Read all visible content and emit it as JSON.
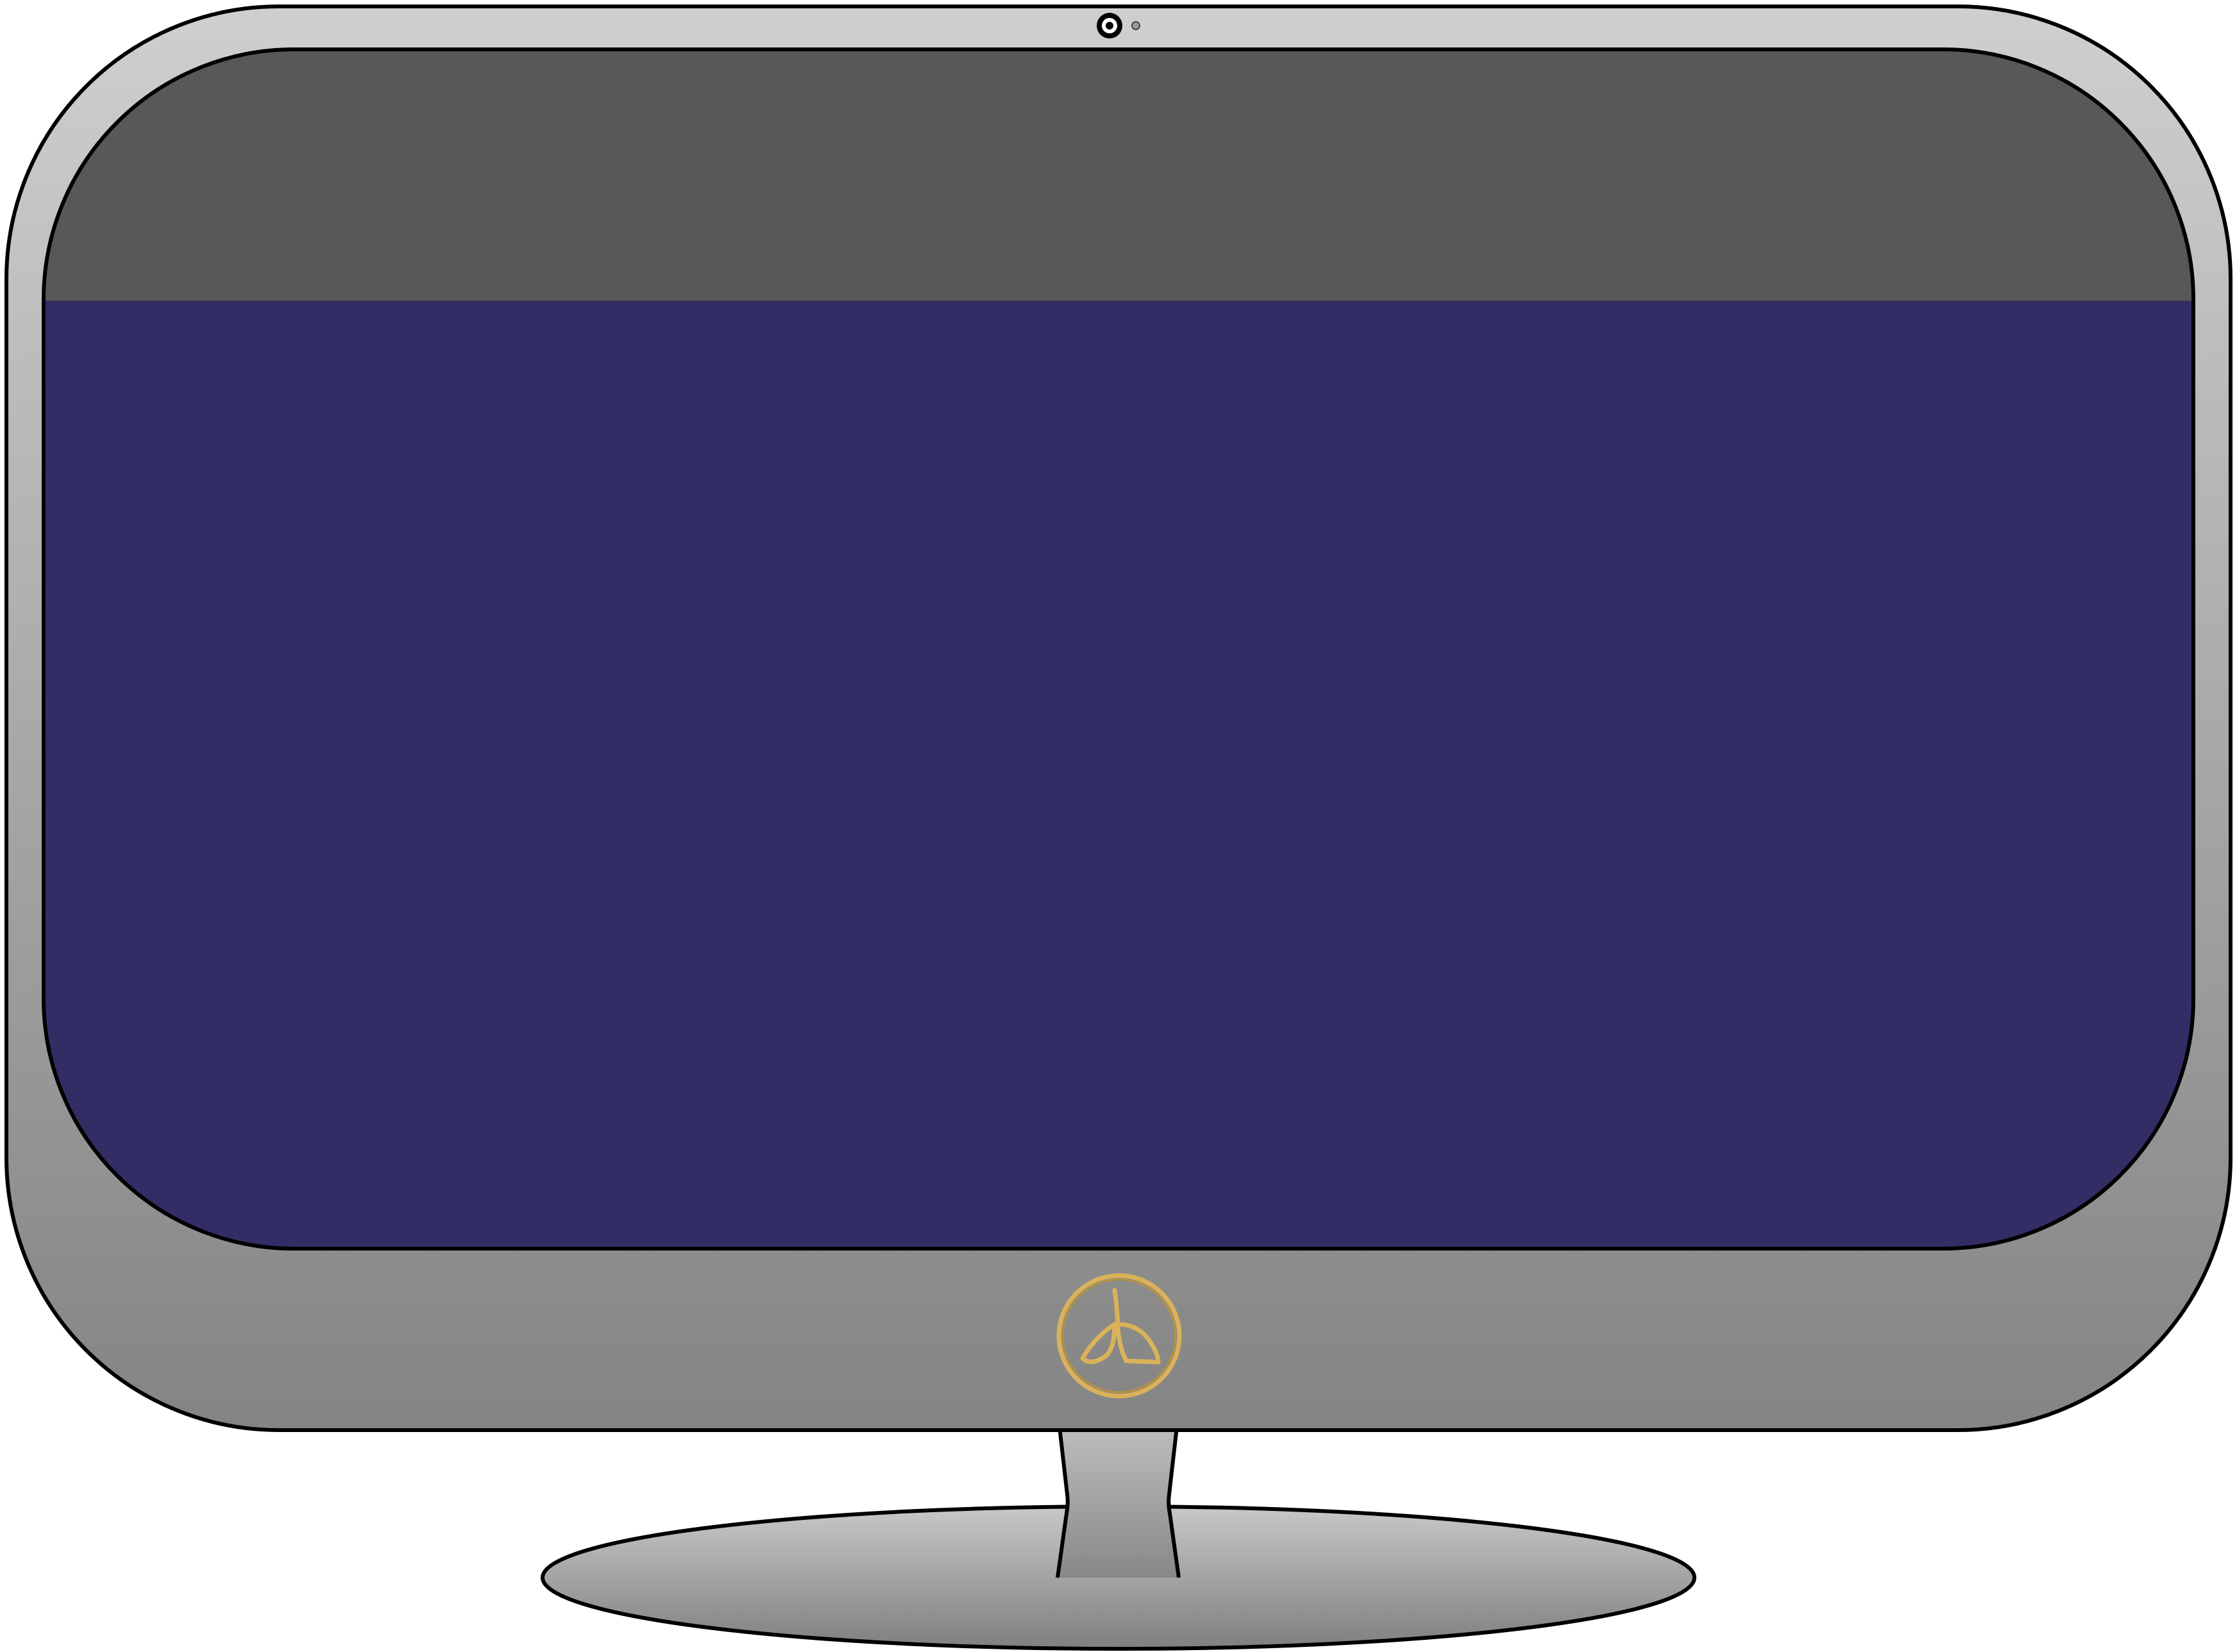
{
  "monitor": {
    "bezel_top_color": "#cfcfcf",
    "bezel_bottom_color": "#848484",
    "outline_color": "#000000",
    "screen_header_color": "#585858",
    "screen_body_color": "#322d65",
    "stand_top_color": "#c8c8c8",
    "stand_bottom_color": "#7f7f7f",
    "logo_color": "#d9b25a",
    "logo_icon": "circle-emblem-icon",
    "camera_icon": "webcam-icon",
    "sensor_icon": "light-sensor-icon"
  }
}
